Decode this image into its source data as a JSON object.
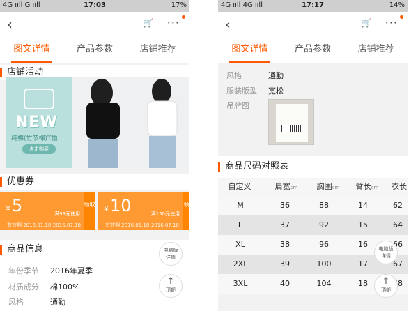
{
  "left": {
    "status": {
      "carrier": "4G ııll G ııll",
      "time": "17:03",
      "battery": "17%"
    },
    "tabs": [
      "图文详情",
      "产品参数",
      "店铺推荐"
    ],
    "shop_activity_title": "店铺活动",
    "banner": {
      "headline": "NEW",
      "subtitle": "纯棉(竹节棉)T恤",
      "button": "点击购买"
    },
    "coupons_title": "优惠券",
    "coupons": [
      {
        "currency": "¥",
        "amount": "5",
        "condition": "满99元使用",
        "validity": "有效期 2016.01.18-2016.07.18",
        "get": "领取"
      },
      {
        "currency": "¥",
        "amount": "10",
        "condition": "满150元使用",
        "validity": "有效期 2016.01.18-2016.07.18",
        "get": "领"
      }
    ],
    "product_info_title": "商品信息",
    "info": [
      {
        "k": "年份季节",
        "v": "2016年夏季"
      },
      {
        "k": "材质成分",
        "v": "棉100%"
      },
      {
        "k": "风格",
        "v": "通勤"
      }
    ],
    "pc_button": "电脑版详情",
    "top_button": "顶部"
  },
  "right": {
    "status": {
      "carrier": "4G ııll 4G ııll",
      "time": "17:17",
      "battery": "14%"
    },
    "tabs": [
      "图文详情",
      "产品参数",
      "店铺推荐"
    ],
    "params": [
      {
        "k": "风格",
        "v": "通勤"
      },
      {
        "k": "服装版型",
        "v": "宽松"
      },
      {
        "k": "吊牌图",
        "v": ""
      }
    ],
    "size_title": "商品尺码对照表",
    "headers": [
      {
        "label": "自定义",
        "unit": ""
      },
      {
        "label": "肩宽",
        "unit": "cm"
      },
      {
        "label": "胸围",
        "unit": "cm"
      },
      {
        "label": "臂长",
        "unit": "cm"
      },
      {
        "label": "衣长",
        "unit": ""
      }
    ],
    "rows": [
      [
        "M",
        "36",
        "88",
        "14",
        "62"
      ],
      [
        "L",
        "37",
        "92",
        "15",
        "64"
      ],
      [
        "XL",
        "38",
        "96",
        "16",
        "66"
      ],
      [
        "2XL",
        "39",
        "100",
        "17",
        "67"
      ],
      [
        "3XL",
        "40",
        "104",
        "18",
        "68"
      ]
    ],
    "pc_button": "电脑版详情",
    "top_button": "顶部"
  },
  "colors": {
    "accent": "#ff5a00",
    "coupon": "#ff9a33"
  }
}
